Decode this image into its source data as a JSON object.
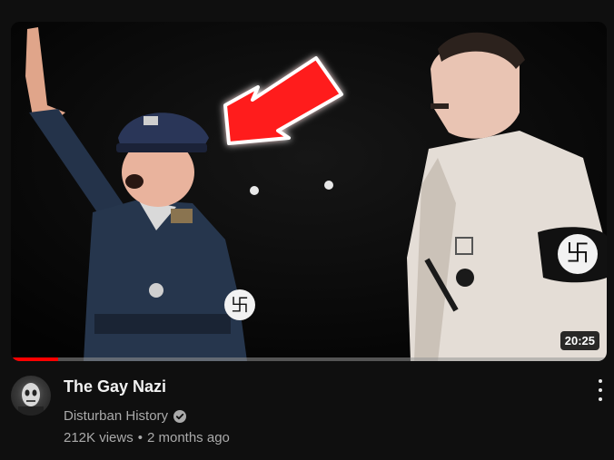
{
  "video": {
    "title": "The Gay Nazi",
    "duration": "20:25",
    "progress_fraction": 0.08
  },
  "channel": {
    "name": "Disturban History",
    "verified": true
  },
  "stats": {
    "views": "212K views",
    "separator": "•",
    "age": "2 months ago"
  },
  "icons": {
    "menu": "more-vert-icon",
    "verified": "verified-check-icon",
    "thumbnail_overlay": "red-arrow-icon"
  },
  "colors": {
    "background": "#0f0f0f",
    "progress": "#ff0000",
    "title": "#f1f1f1",
    "secondary_text": "#aaaaaa",
    "arrow": "#ff1a1a"
  }
}
